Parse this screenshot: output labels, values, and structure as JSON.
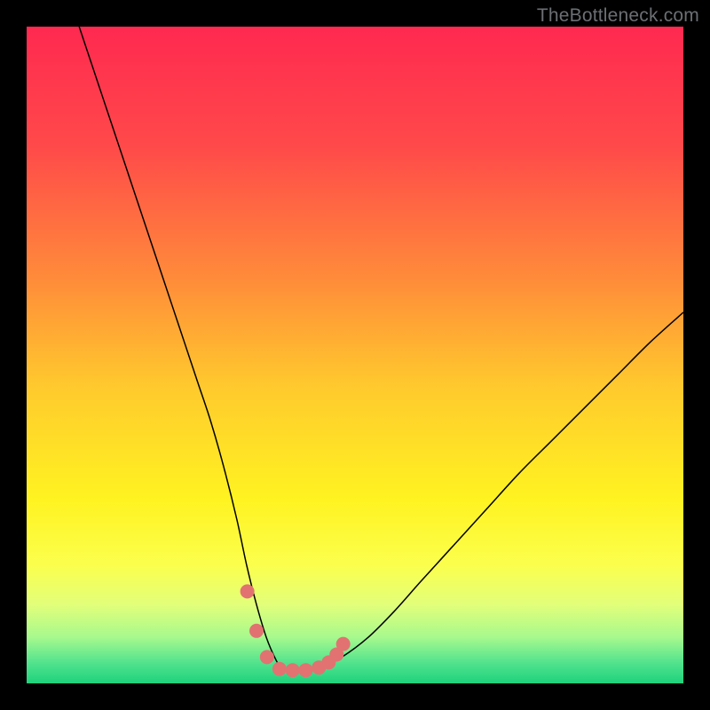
{
  "watermark": "TheBottleneck.com",
  "chart_data": {
    "type": "line",
    "title": "",
    "xlabel": "",
    "ylabel": "",
    "xlim": [
      0,
      100
    ],
    "ylim": [
      0,
      100
    ],
    "grid": false,
    "legend": false,
    "background_gradient_stops": [
      {
        "offset": 0.0,
        "color": "#ff2950"
      },
      {
        "offset": 0.18,
        "color": "#ff494a"
      },
      {
        "offset": 0.38,
        "color": "#ff8a3a"
      },
      {
        "offset": 0.55,
        "color": "#ffca2d"
      },
      {
        "offset": 0.72,
        "color": "#fff321"
      },
      {
        "offset": 0.82,
        "color": "#fbff4d"
      },
      {
        "offset": 0.88,
        "color": "#e2ff7a"
      },
      {
        "offset": 0.93,
        "color": "#a6f98d"
      },
      {
        "offset": 0.97,
        "color": "#4fe28d"
      },
      {
        "offset": 1.0,
        "color": "#1ed27c"
      }
    ],
    "series": [
      {
        "name": "bottleneck-curve",
        "color": "#000000",
        "width": 1.5,
        "x": [
          8,
          10,
          12,
          14,
          16,
          18,
          20,
          22,
          24,
          26,
          28,
          30,
          32,
          33.5,
          35,
          36.5,
          38,
          39,
          40,
          42,
          45,
          48,
          52,
          56,
          60,
          65,
          70,
          75,
          80,
          85,
          90,
          95,
          100
        ],
        "y": [
          100,
          94,
          88,
          82,
          76,
          70,
          64,
          58,
          52,
          46,
          40,
          33,
          25,
          18,
          12,
          7,
          3.5,
          2,
          2,
          2,
          2.5,
          4,
          7,
          11,
          15.5,
          21,
          26.5,
          32,
          37,
          42,
          47,
          52,
          56.5
        ]
      },
      {
        "name": "highlight-dots",
        "type": "scatter",
        "color": "#e27272",
        "radius": 8,
        "x": [
          33.6,
          35.0,
          36.6,
          38.5,
          40.5,
          42.5,
          44.5,
          46.0,
          47.2,
          48.2
        ],
        "y": [
          14.0,
          8.0,
          4.0,
          2.2,
          2.0,
          2.0,
          2.4,
          3.2,
          4.4,
          6.0
        ]
      }
    ]
  }
}
